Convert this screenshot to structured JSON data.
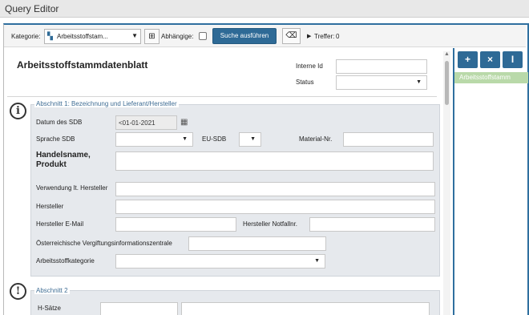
{
  "window": {
    "title": "Query Editor"
  },
  "toolbar": {
    "kategorie_label": "Kategorie:",
    "kategorie_value": "Arbeitsstoffstam...",
    "abhaengige_label": "Abhängige:",
    "abhaengige_checked": false,
    "search_button": "Suche ausführen",
    "treffer_label": "Treffer:",
    "treffer_count": "0"
  },
  "side": {
    "buttons": [
      "+",
      "×",
      "I"
    ],
    "items": [
      "Arbeitsstoffstamm"
    ]
  },
  "form": {
    "title": "Arbeitsstoffstammdatenblatt",
    "interne_id_label": "Interne Id",
    "interne_id_value": "",
    "status_label": "Status",
    "status_value": "",
    "section1": {
      "legend": "Abschnitt 1: Bezeichnung und Lieferant/Hersteller",
      "icon": "info-icon",
      "datum_label": "Datum des SDB",
      "datum_value": "<01-01-2021",
      "sprache_label": "Sprache SDB",
      "eu_sdb_label": "EU-SDB",
      "material_label": "Material-Nr.",
      "handelsname_label_1": "Handelsname,",
      "handelsname_label_2": "Produkt",
      "verwendung_label": "Verwendung lt. Hersteller",
      "hersteller_label": "Hersteller",
      "hersteller_email_label": "Hersteller E-Mail",
      "hersteller_notfall_label": "Hersteller Notfallnr.",
      "vergiftung_label": "Österreichische Vergiftungsinformationszentrale",
      "kategorie_label": "Arbeitsstoffkategorie"
    },
    "section2": {
      "legend": "Abschnitt 2",
      "icon": "warning-icon",
      "h_saetze_label": "H-Sätze"
    }
  },
  "colors": {
    "accent": "#2e6a96",
    "section_bg": "#e6e9ed",
    "legend": "#3f6d94",
    "selected_item": "#b9d9a9"
  }
}
